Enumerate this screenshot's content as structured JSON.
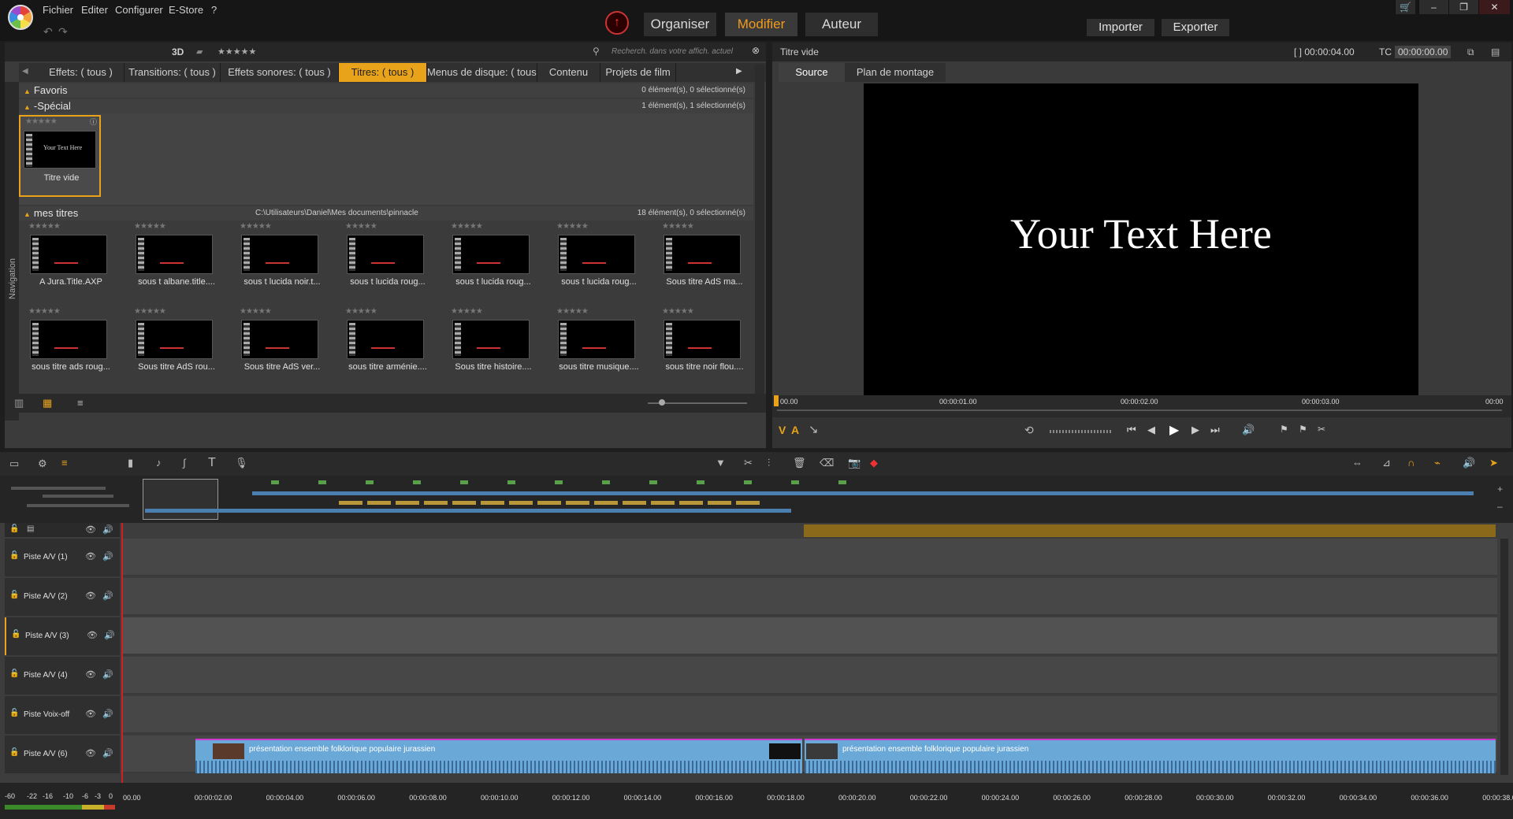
{
  "menu": [
    "Fichier",
    "Editer",
    "Configurer",
    "E-Store"
  ],
  "mode_tabs": [
    "Organiser",
    "Modifier",
    "Auteur"
  ],
  "top_buttons": {
    "import": "Importer",
    "export": "Exporter"
  },
  "library": {
    "header": {
      "label3d": "3D",
      "stars": "★★★★★",
      "search_placeholder": "Recherch. dans votre affich. actuel"
    },
    "tabs": [
      "Effets: ( tous )",
      "Transitions: ( tous )",
      "Effets sonores: ( tous )",
      "Titres: ( tous )",
      "Menus de disque: ( tous )",
      "Contenu",
      "Projets de film"
    ],
    "nav_label": "Navigation",
    "sections": {
      "favoris": {
        "title": "Favoris",
        "info": "0 élément(s), 0 sélectionné(s)"
      },
      "special": {
        "title": "-Spécial",
        "info": "1 élément(s), 1 sélectionné(s)"
      },
      "mes_titres": {
        "title": "mes titres",
        "path": "C:\\Utilisateurs\\Daniel\\Mes documents\\pinnacle",
        "info": "18 élément(s), 0 sélectionné(s)"
      }
    },
    "special_item": {
      "label": "Titre vide",
      "thumb_text": "Your Text Here"
    },
    "items": [
      "A Jura.Title.AXP",
      "sous t albane.title....",
      "sous t lucida noir.t...",
      "sous t lucida roug...",
      "sous t lucida roug...",
      "sous t lucida roug...",
      "Sous titre AdS ma...",
      "sous titre ads roug...",
      "Sous titre AdS rou...",
      "Sous titre AdS ver...",
      "sous titre arménie....",
      "Sous titre histoire....",
      "sous titre musique....",
      "sous titre noir flou...."
    ],
    "empty_stars": "★★★★★"
  },
  "preview": {
    "title": "Titre vide",
    "duration": "[ ] 00:00:04.00",
    "tc_label": "TC",
    "tc_value": "00:00:00.00",
    "tabs": [
      "Source",
      "Plan de montage"
    ],
    "screen_text": "Your Text Here",
    "ruler": [
      "00.00",
      "00:00:01.00",
      "00:00:02.00",
      "00:00:03.00",
      "00:00"
    ]
  },
  "timeline": {
    "tracks": [
      "Piste A/V (1)",
      "Piste A/V (2)",
      "Piste A/V (3)",
      "Piste A/V (4)",
      "Piste Voix-off",
      "Piste A/V (6)"
    ],
    "clip1": "présentation ensemble folklorique populaire jurassien",
    "clip2": "présentation ensemble folklorique populaire jurassien",
    "ruler": [
      "00.00",
      "00:00:02.00",
      "00:00:04.00",
      "00:00:06.00",
      "00:00:08.00",
      "00:00:10.00",
      "00:00:12.00",
      "00:00:14.00",
      "00:00:16.00",
      "00:00:18.00",
      "00:00:20.00",
      "00:00:22.00",
      "00:00:24.00",
      "00:00:26.00",
      "00:00:28.00",
      "00:00:30.00",
      "00:00:32.00",
      "00:00:34.00",
      "00:00:36.00",
      "00:00:38.0"
    ],
    "meter": [
      "-60",
      "-22",
      "-16",
      "-10",
      "-6",
      "-3",
      "0"
    ]
  },
  "colors": {
    "accent": "#e9a31a",
    "active_mode": "#f29a1c",
    "clip": "#6aa8d8",
    "playhead": "#d02020"
  }
}
